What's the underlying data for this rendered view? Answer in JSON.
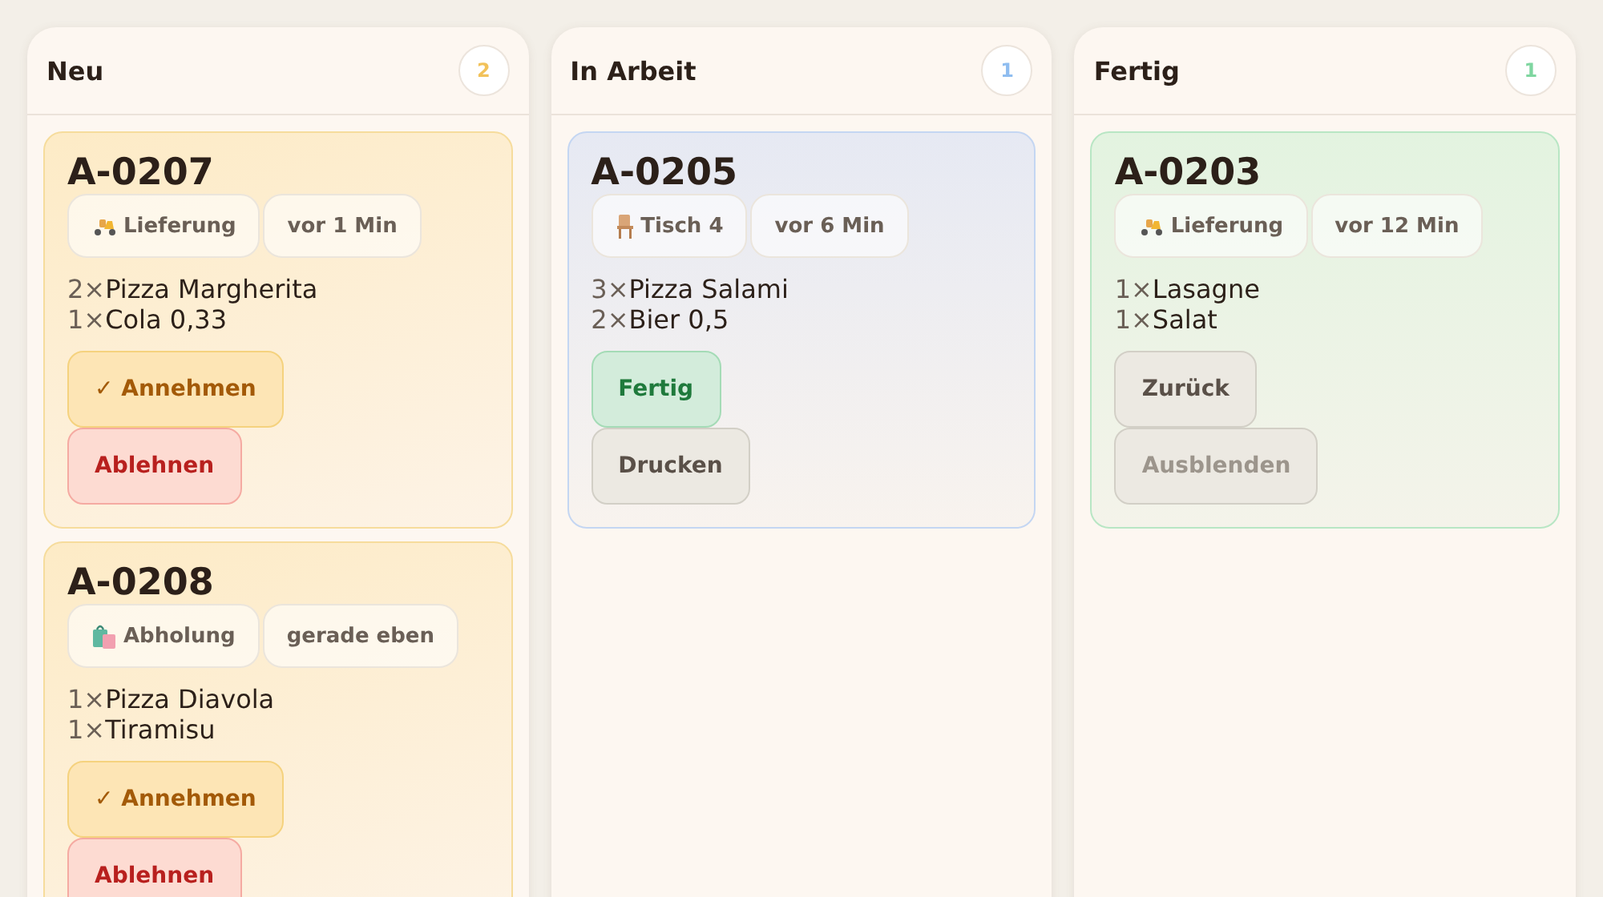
{
  "columns": [
    {
      "title": "Neu",
      "count": "2",
      "kind": "new",
      "orders": [
        {
          "id": "A-0207",
          "chips": [
            {
              "kind": "delivery",
              "label": "Lieferung"
            },
            {
              "kind": "time",
              "label": "vor 1 Min"
            }
          ],
          "items": [
            {
              "qty": "2×",
              "name": "Pizza Margherita"
            },
            {
              "qty": "1×",
              "name": "Cola 0,33"
            }
          ],
          "actions": [
            {
              "kind": "accept",
              "label": "✓ Annehmen"
            },
            {
              "kind": "reject",
              "label": "Ablehnen"
            }
          ]
        },
        {
          "id": "A-0208",
          "chips": [
            {
              "kind": "pickup",
              "label": "Abholung"
            },
            {
              "kind": "time",
              "label": "gerade eben"
            }
          ],
          "items": [
            {
              "qty": "1×",
              "name": "Pizza Diavola"
            },
            {
              "qty": "1×",
              "name": "Tiramisu"
            }
          ],
          "actions": [
            {
              "kind": "accept",
              "label": "✓ Annehmen"
            },
            {
              "kind": "reject",
              "label": "Ablehnen"
            }
          ]
        }
      ]
    },
    {
      "title": "In Arbeit",
      "count": "1",
      "kind": "progress",
      "orders": [
        {
          "id": "A-0205",
          "chips": [
            {
              "kind": "table",
              "label": "Tisch 4"
            },
            {
              "kind": "time",
              "label": "vor 6 Min"
            }
          ],
          "items": [
            {
              "qty": "3×",
              "name": "Pizza Salami"
            },
            {
              "qty": "2×",
              "name": "Bier 0,5"
            }
          ],
          "actions": [
            {
              "kind": "done",
              "label": "Fertig"
            },
            {
              "kind": "neutral",
              "label": "Drucken"
            }
          ]
        }
      ]
    },
    {
      "title": "Fertig",
      "count": "1",
      "kind": "ready",
      "orders": [
        {
          "id": "A-0203",
          "chips": [
            {
              "kind": "delivery",
              "label": "Lieferung"
            },
            {
              "kind": "time",
              "label": "vor 12 Min"
            }
          ],
          "items": [
            {
              "qty": "1×",
              "name": "Lasagne"
            },
            {
              "qty": "1×",
              "name": "Salat"
            }
          ],
          "actions": [
            {
              "kind": "neutral",
              "label": "Zurück"
            },
            {
              "kind": "muted",
              "label": "Ausblenden"
            }
          ]
        }
      ]
    }
  ]
}
